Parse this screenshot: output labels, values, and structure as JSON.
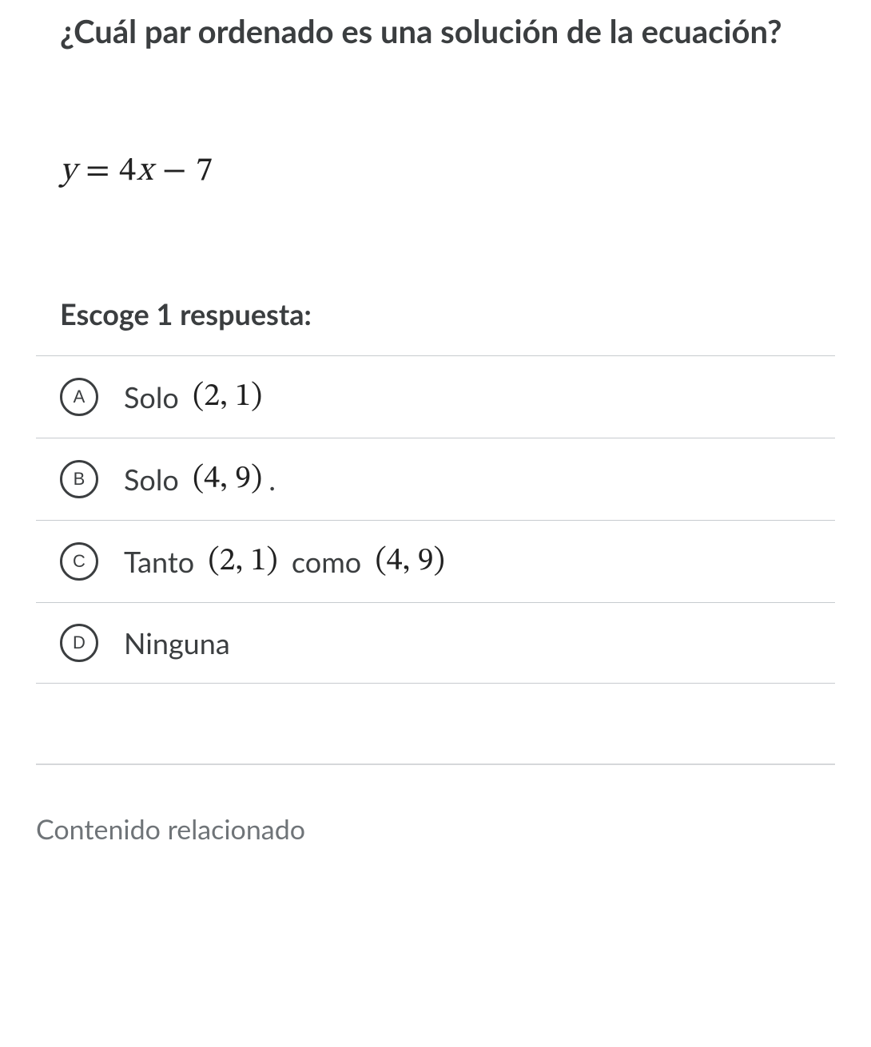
{
  "question": "¿Cuál par ordenado es una solución de la ecuación?",
  "equation": {
    "lhs_var": "y",
    "rhs": "4x − 7",
    "full": "y = 4x − 7"
  },
  "prompt": "Escoge 1 respuesta:",
  "choices": [
    {
      "letter": "A",
      "prefix": "Solo ",
      "pair1": "(2, 1)",
      "mid": "",
      "pair2": "",
      "suffix": ""
    },
    {
      "letter": "B",
      "prefix": "Solo ",
      "pair1": "(4, 9)",
      "mid": "",
      "pair2": "",
      "suffix": "."
    },
    {
      "letter": "C",
      "prefix": "Tanto ",
      "pair1": "(2, 1)",
      "mid": " como ",
      "pair2": "(4, 9)",
      "suffix": ""
    },
    {
      "letter": "D",
      "prefix": "Ninguna",
      "pair1": "",
      "mid": "",
      "pair2": "",
      "suffix": ""
    }
  ],
  "related_heading": "Contenido relacionado"
}
